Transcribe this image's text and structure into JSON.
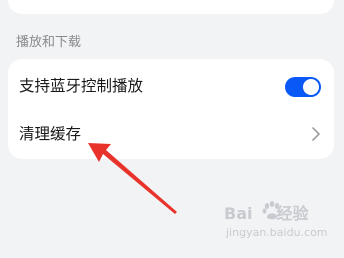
{
  "section": {
    "title": "播放和下载"
  },
  "settings": {
    "rows": [
      {
        "label": "支持蓝牙控制播放",
        "control": "toggle",
        "enabled": true
      },
      {
        "label": "清理缓存",
        "control": "chevron-right-icon"
      }
    ]
  },
  "annotation": {
    "arrow_color": "#e8332b"
  },
  "watermark": {
    "logo_left": "Bai",
    "logo_right": "经验",
    "subtitle": "jingyan.baidu.com"
  },
  "colors": {
    "accent": "#0a59f7",
    "background": "#f1f3f5",
    "card": "#ffffff"
  }
}
